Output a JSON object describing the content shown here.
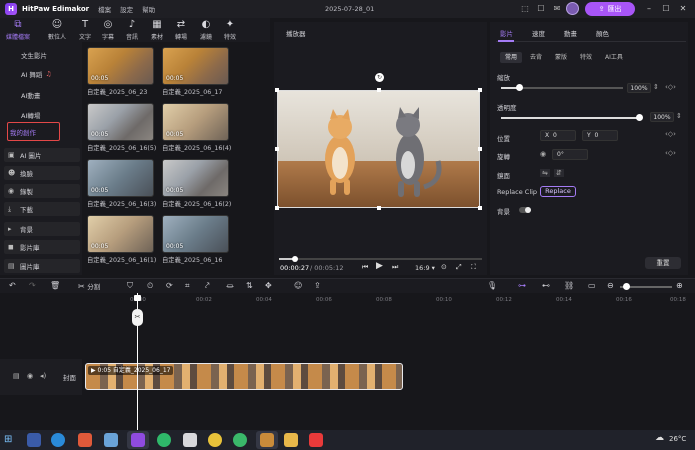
{
  "titlebar": {
    "app_name": "HitPaw Edimakor",
    "menu": [
      "檔案",
      "設定",
      "幫助"
    ],
    "document_title": "2025-07-28_01",
    "export_label": "匯出"
  },
  "toolbar": {
    "items": [
      {
        "label": "媒體檔案",
        "icon": "media-icon",
        "glyph": "⧉"
      },
      {
        "label": "數位人",
        "icon": "avatar-icon",
        "glyph": "☺"
      },
      {
        "label": "文字",
        "icon": "text-icon",
        "glyph": "T"
      },
      {
        "label": "字幕",
        "icon": "subtitle-icon",
        "glyph": "◎"
      },
      {
        "label": "音訊",
        "icon": "audio-icon",
        "glyph": "♪"
      },
      {
        "label": "素材",
        "icon": "sticker-icon",
        "glyph": "▦"
      },
      {
        "label": "轉場",
        "icon": "transition-icon",
        "glyph": "⇄"
      },
      {
        "label": "濾鏡",
        "icon": "filter-icon",
        "glyph": "◐"
      },
      {
        "label": "特效",
        "icon": "effects-icon",
        "glyph": "✦"
      }
    ]
  },
  "leftnav": {
    "ai_sub": [
      "文生影片",
      "AI 舞蹈",
      "AI動畫",
      "AI轉場",
      "我的創作"
    ],
    "groups": [
      {
        "label": "AI 圖片",
        "glyph": "▣"
      },
      {
        "label": "換臉",
        "glyph": "☻"
      },
      {
        "label": "錄製",
        "glyph": "◉"
      },
      {
        "label": "下載",
        "glyph": "⤓"
      },
      {
        "label": "背景",
        "glyph": "▸"
      },
      {
        "label": "影片庫",
        "glyph": "◼"
      },
      {
        "label": "圖片庫",
        "glyph": "▤"
      }
    ]
  },
  "media": {
    "items": [
      {
        "duration": "00:05",
        "label": "自定義_2025_06_23"
      },
      {
        "duration": "00:05",
        "label": "自定義_2025_06_17"
      },
      {
        "duration": "00:05",
        "label": "自定義_2025_06_16(5)"
      },
      {
        "duration": "00:05",
        "label": "自定義_2025_06_16(4)"
      },
      {
        "duration": "00:05",
        "label": "自定義_2025_06_16(3)"
      },
      {
        "duration": "00:05",
        "label": "自定義_2025_06_16(2)"
      },
      {
        "duration": "00:05",
        "label": "自定義_2025_06_16(1)"
      },
      {
        "duration": "00:05",
        "label": "自定義_2025_06_16"
      }
    ]
  },
  "player": {
    "title": "播放器",
    "current_time": "00:00:27",
    "total_time": "/ 00:05:12",
    "aspect": "16:9",
    "progress_fraction": 0.08
  },
  "props": {
    "tabs": [
      "影片",
      "速度",
      "動畫",
      "顏色"
    ],
    "subtabs": [
      "常用",
      "去背",
      "蒙版",
      "特效",
      "AI工具"
    ],
    "scale_label": "縮放",
    "scale_value": "100%",
    "scale_fraction": 0.15,
    "opacity_label": "透明度",
    "opacity_value": "100%",
    "opacity_fraction": 1.0,
    "position_label": "位置",
    "x_label": "X",
    "x_value": "0",
    "y_label": "Y",
    "y_value": "0",
    "rotate_label": "旋轉",
    "rotate_value": "0°",
    "mirror_label": "鏡面",
    "replace_label": "Replace Clip",
    "replace_btn": "Replace",
    "background_label": "背景",
    "reset_label": "重置"
  },
  "timeline": {
    "tools": {
      "split_label": "分割"
    },
    "ruler": [
      "00:00",
      "00:02",
      "00:04",
      "00:06",
      "00:08",
      "00:10",
      "00:12",
      "00:14",
      "00:16",
      "00:18"
    ],
    "track_label": "封面",
    "clip_label": "0:05 自定義_2025_06_17"
  },
  "taskbar": {
    "temperature": "26°C"
  },
  "colors": {
    "accent": "#a855f7",
    "highlight_border": "#e34848"
  }
}
